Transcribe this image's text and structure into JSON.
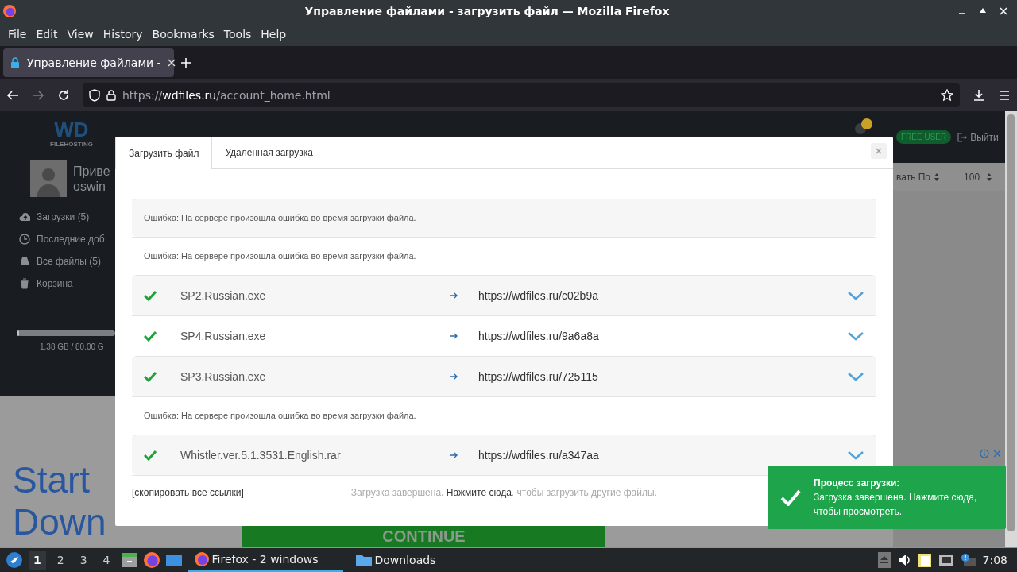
{
  "window": {
    "title": "Управление файлами - загрузить файл — Mozilla Firefox"
  },
  "menu": [
    "File",
    "Edit",
    "View",
    "History",
    "Bookmarks",
    "Tools",
    "Help"
  ],
  "browser_tabs": [
    {
      "label": "Управление файлами -",
      "selected": true
    }
  ],
  "toolbar": {
    "back": {
      "disabled": false
    },
    "forward": {
      "disabled": true
    }
  },
  "url": {
    "scheme": "https://",
    "host": "wdfiles.ru",
    "path": "/account_home.html"
  },
  "page": {
    "logo_text": "WD",
    "logo_caption": "FILEHOSTING",
    "greeting": "Приве",
    "username": "oswin",
    "sidebar": [
      {
        "label": "Загрузки (5)"
      },
      {
        "label": "Последние доб"
      },
      {
        "label": "Все файлы (5)"
      },
      {
        "label": "Корзина"
      }
    ],
    "storage": {
      "level": 0.02,
      "text": "1.38 GB / 80.00 G"
    },
    "plan_badge": "FREE USER",
    "logout": "Выйти",
    "sort_label": "вать По",
    "per_page": "100",
    "ad": {
      "headline": "Start",
      "headline_2": "Down",
      "button": "CONTINUE"
    }
  },
  "modal": {
    "tabs": [
      {
        "label": "Загрузить файл",
        "selected": true
      },
      {
        "label": "Удаленная загрузка",
        "selected": false
      }
    ],
    "rows": [
      {
        "kind": "error",
        "text": "Ошибка: На сервере произошла ошибка во время загрузки файла."
      },
      {
        "kind": "error",
        "text": "Ошибка: На сервере произошла ошибка во время загрузки файла."
      },
      {
        "kind": "file",
        "name": "SP2.Russian.exe",
        "link": "https://wdfiles.ru/c02b9a",
        "done": true
      },
      {
        "kind": "file",
        "name": "SP4.Russian.exe",
        "link": "https://wdfiles.ru/9a6a8a",
        "done": true
      },
      {
        "kind": "file",
        "name": "SP3.Russian.exe",
        "link": "https://wdfiles.ru/725115",
        "done": true
      },
      {
        "kind": "error",
        "text": "Ошибка: На сервере произошла ошибка во время загрузки файла."
      },
      {
        "kind": "file",
        "name": "Whistler.ver.5.1.3531.English.rar",
        "link": "https://wdfiles.ru/a347aa",
        "done": true
      }
    ],
    "copy_all": "[скопировать все ссылки]",
    "status": {
      "before": "Загрузка завершена.",
      "link": "Нажмите сюда",
      "after": ". чтобы загрузить другие файлы."
    }
  },
  "toast": {
    "title": "Процесс загрузки:",
    "message": "Загрузка завершена. Нажмите сюда, чтобы просмотреть."
  },
  "taskbar": {
    "workspaces": [
      {
        "label": "1",
        "selected": true
      },
      {
        "label": "2",
        "selected": false
      },
      {
        "label": "3",
        "selected": false
      },
      {
        "label": "4",
        "selected": false
      }
    ],
    "tasks": [
      {
        "label": "Firefox - 2 windows",
        "selected": true
      },
      {
        "label": "Downloads",
        "selected": false
      }
    ],
    "clock": "7:08"
  }
}
